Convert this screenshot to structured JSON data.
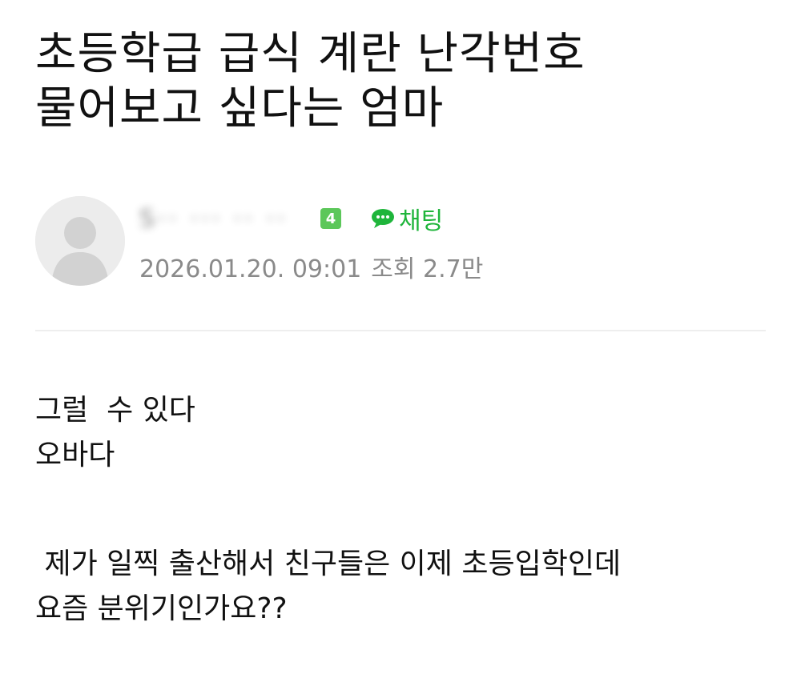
{
  "post": {
    "title_line1": "초등학급 급식 계란 난각번호",
    "title_line2": "물어보고 싶다는 엄마",
    "author": {
      "nickname": "S·· ··· ·· ··",
      "level": "4",
      "chat_label": "채팅"
    },
    "date": "2026.01.20. 09:01",
    "views": "조회 2.7만",
    "body": {
      "p1_line1": "그럴  수 있다",
      "p1_line2": "오바다",
      "p2_line1": " 제가 일찍 출산해서 친구들은 이제 초등입학인데",
      "p2_line2": "요즘 분위기인가요??"
    }
  },
  "colors": {
    "accent_green": "#1fb53b",
    "badge_green": "#5cc75a",
    "meta_gray": "#8a8a8a"
  },
  "icons": {
    "avatar": "default-avatar-icon",
    "chat": "chat-bubble-icon"
  }
}
